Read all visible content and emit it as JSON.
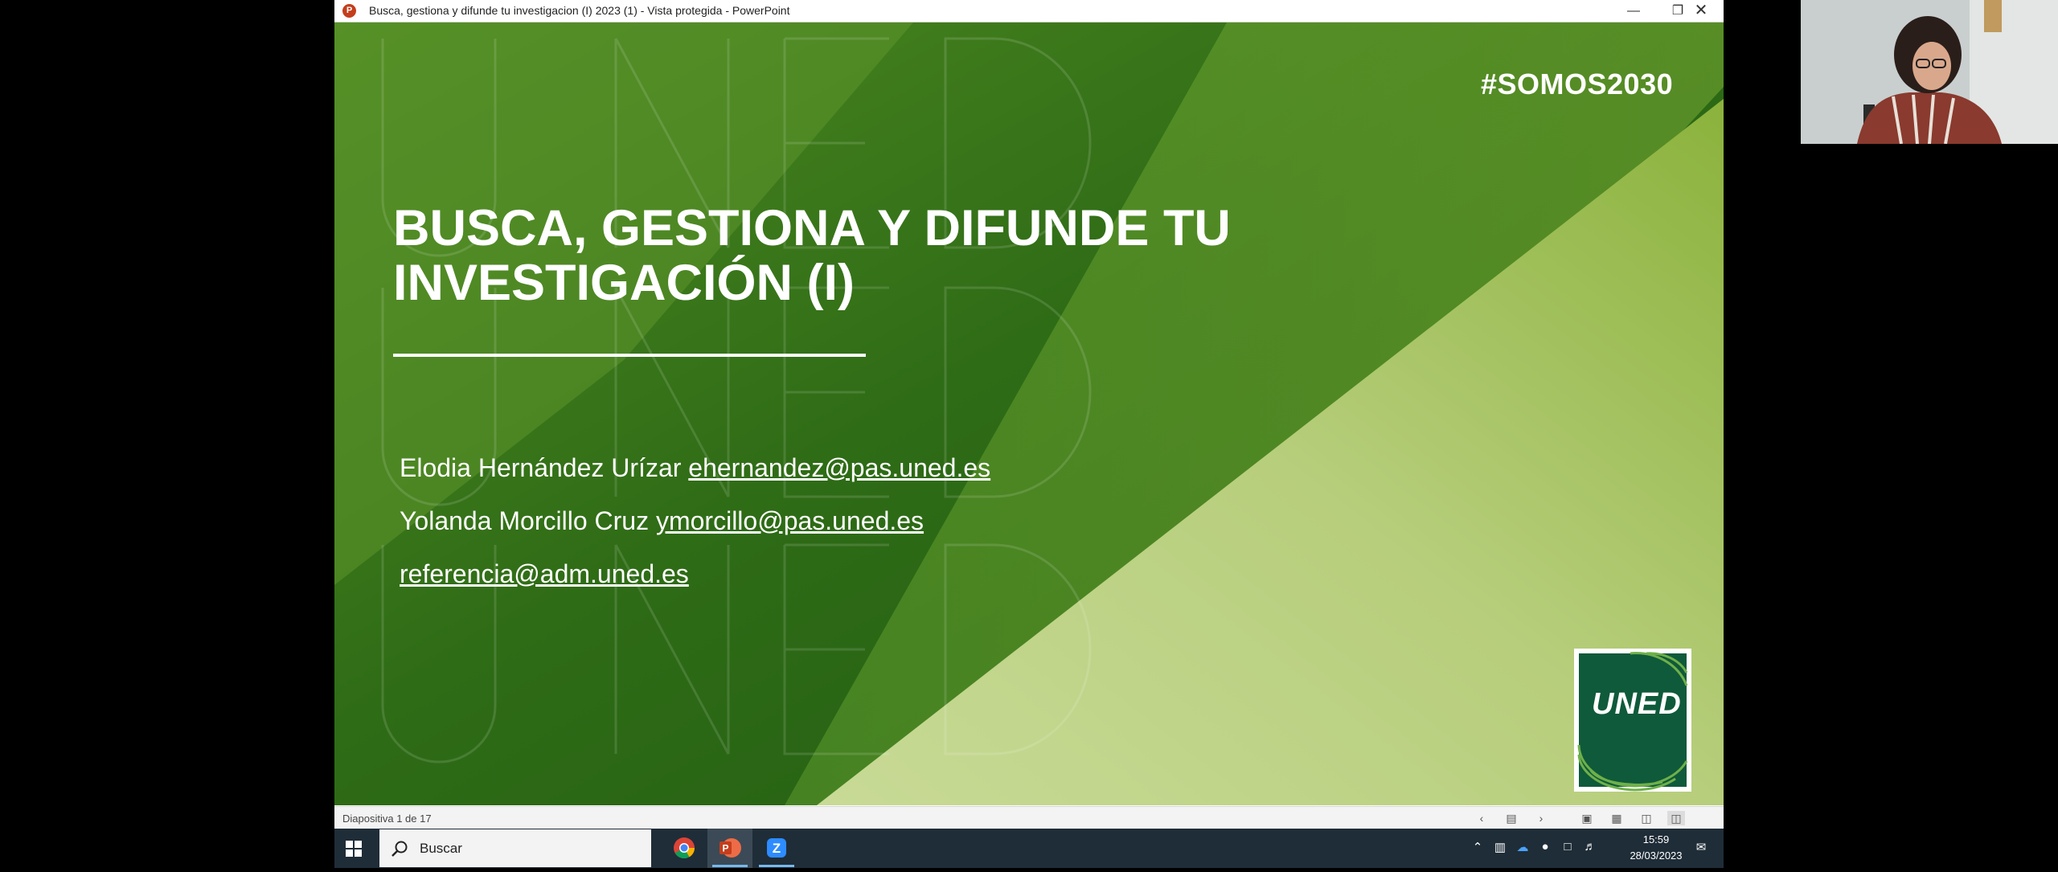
{
  "window": {
    "title": "Busca, gestiona y difunde tu investigacion (I) 2023 (1)  -  Vista protegida  -  PowerPoint",
    "app_icon": "powerpoint-icon",
    "controls": [
      "minimize-icon",
      "restore-icon",
      "close-icon"
    ]
  },
  "slide": {
    "hashtag": "#SOMOS2030",
    "title_line1": "BUSCA, GESTIONA Y DIFUNDE TU",
    "title_line2": "INVESTIGACIÓN (I)",
    "authors": [
      {
        "name": "Elodia Hernández Urízar",
        "email": "ehernandez@pas.uned.es"
      },
      {
        "name": "Yolanda Morcillo Cruz",
        "email": "ymorcillo@pas.uned.es"
      }
    ],
    "contact_email": "referencia@adm.uned.es",
    "logo_text": "UNED",
    "colors": {
      "dark_green": "#1f5a14",
      "light_green": "#c3d68b",
      "logo_green": "#0f5a3a"
    }
  },
  "statusbar": {
    "slide_counter": "Diapositiva 1 de 17",
    "icons": [
      "prev-slide-icon",
      "slide-view-icon",
      "next-slide-icon",
      "normal-view-icon",
      "slide-sorter-icon",
      "reading-view-icon",
      "slideshow-icon"
    ]
  },
  "taskbar": {
    "search_placeholder": "Buscar",
    "apps": [
      "chrome-icon",
      "powerpoint-icon",
      "zoom-icon"
    ],
    "time": "15:59",
    "date": "28/03/2023"
  }
}
